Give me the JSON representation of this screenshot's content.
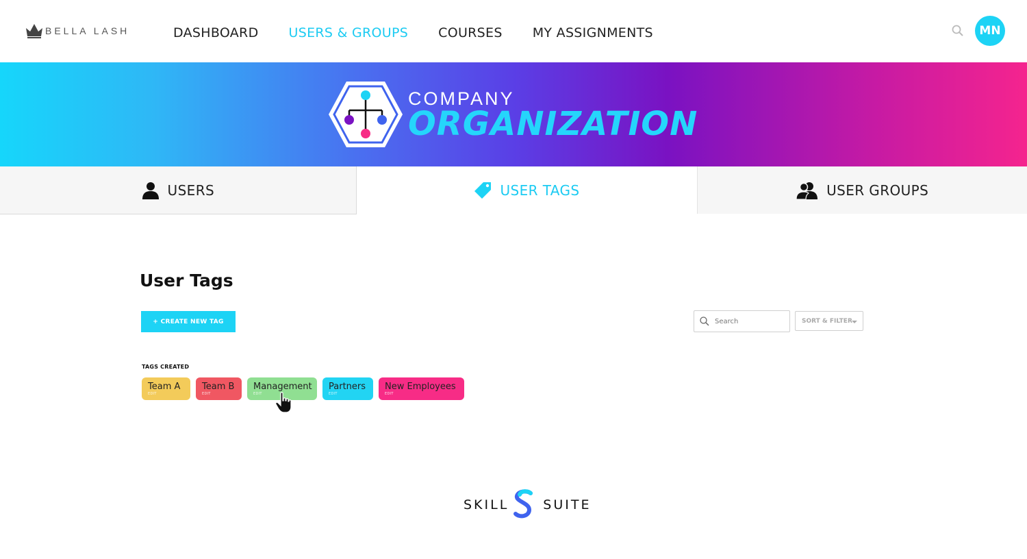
{
  "header": {
    "brand": "BELLA LASH",
    "nav": [
      {
        "label": "DASHBOARD",
        "active": false
      },
      {
        "label": "USERS & GROUPS",
        "active": true
      },
      {
        "label": "COURSES",
        "active": false
      },
      {
        "label": "MY ASSIGNMENTS",
        "active": false
      }
    ],
    "avatar_initials": "MN",
    "search_icon": "search-icon"
  },
  "banner": {
    "subtitle": "COMPANY",
    "title": "ORGANIZATION",
    "icon": "org-chart-hexagon-icon"
  },
  "tabs": [
    {
      "label": "USERS",
      "icon": "user-icon",
      "active": false
    },
    {
      "label": "USER TAGS",
      "icon": "tag-icon",
      "active": true
    },
    {
      "label": "USER GROUPS",
      "icon": "users-group-icon",
      "active": false
    }
  ],
  "main": {
    "title": "User Tags",
    "create_button": "+ CREATE NEW TAG",
    "search_placeholder": "Search",
    "sort_filter": "SORT & FILTER",
    "tags_label": "TAGS CREATED",
    "tags": [
      {
        "name": "Team A",
        "edit": "EDIT",
        "color": "#f3cb5a"
      },
      {
        "name": "Team B",
        "edit": "EDIT",
        "color": "#f05762"
      },
      {
        "name": "Management",
        "edit": "EDIT",
        "color": "#90df92"
      },
      {
        "name": "Partners",
        "edit": "EDIT",
        "color": "#22d4f3"
      },
      {
        "name": "New Employees",
        "edit": "EDIT",
        "color": "#f72c86"
      }
    ]
  },
  "footer": {
    "left": "SKILL",
    "right": "SUITE"
  },
  "colors": {
    "accent": "#1dd3f5",
    "banner_start": "#16d6fb",
    "banner_mid": "#7a12c2",
    "banner_end": "#f5248e"
  }
}
